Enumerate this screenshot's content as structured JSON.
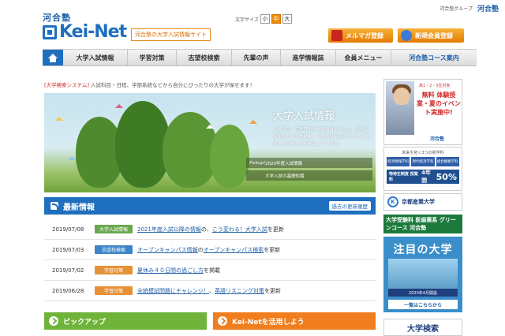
{
  "header": {
    "group_text": "河合塾グループ",
    "group_brand": "河合塾",
    "logo_small": "河合塾",
    "logo_text": "Kei-Net",
    "tagline": "河合塾の大学入試情報サイト",
    "font_size_label": "文字サイズ",
    "font_sizes": [
      "小",
      "中",
      "大"
    ],
    "mail_button": "メルマガ登録",
    "register_button": "新規会員登録"
  },
  "nav": {
    "items": [
      "大学入試情報",
      "学習対策",
      "志望校検索",
      "先輩の声",
      "進学情報誌",
      "会員メニュー",
      "河合塾コース案内"
    ]
  },
  "intro": {
    "tag": "[大学検索システム]",
    "text": " 入試科目・日程、学部系統などから自分にぴったりの大学が探せます！"
  },
  "hero": {
    "title": "大学入試情報",
    "body": "入試科目・日程等の詳細情報はもちろん、過去の倍率などの入試結果、入試の仕組みをやさしく解説した記事などを掲載しています。",
    "link1": "2020年度入試情報",
    "link1_prefix": "Pickup!",
    "link2": "大学入試の基礎知識"
  },
  "news": {
    "title": "最新情報",
    "past_link": "過去の更新履歴",
    "items": [
      {
        "date": "2019/07/08",
        "category": "大学入試情報",
        "cat_color": "#6aa84f",
        "link1": "2021年度入試以降の情報",
        "mid": "の、",
        "link2": "こう変わる！大学入試",
        "tail": "を更新"
      },
      {
        "date": "2019/07/03",
        "category": "志望校検索",
        "cat_color": "#3d85c6",
        "link1": "オープンキャンパス情報",
        "mid": "の",
        "link2": "オープンキャンパス検索",
        "tail": "を更新"
      },
      {
        "date": "2019/07/02",
        "category": "学習対策",
        "cat_color": "#e69138",
        "link1": "夏休み４０日間の過ごし方",
        "mid": "",
        "link2": "",
        "tail": "を掲載"
      },
      {
        "date": "2019/06/28",
        "category": "学習対策",
        "cat_color": "#e69138",
        "link1": "全統模試問題にチャレンジ！",
        "mid": "、",
        "link2": "英語リスニング対策",
        "tail": "を更新"
      }
    ]
  },
  "boxes": {
    "pickup": "ピックアップ",
    "use": "Kei-Netを活用しよう"
  },
  "sidebar": {
    "ad1_top": "高1・2・3生対象",
    "ad1_main": "無料 体験授業・夏のイベント実施中!",
    "ad1_logo": "河合塾",
    "ad2_title": "未来を拓く3つの新学科",
    "ad2_cells": [
      "経済情報学科",
      "現代経済学科",
      "総合観察学科"
    ],
    "ad2_bar_left": "特待生制度 授業料",
    "ad2_bar_mid": "4年間",
    "ad2_bar_right": "50%",
    "ad3": "京都産業大学",
    "ad4": "大学受験科 医歯薬系 グリーンコース 河合塾",
    "ad5_title": "注目の大学",
    "ad5_date": "2020年4月開設",
    "ad5_button": "一覧はこちらから",
    "ad6": "大学検索"
  },
  "colors": {
    "brand": "#1f6fbf",
    "accent": "#f07d1e",
    "green": "#6fb33a"
  }
}
